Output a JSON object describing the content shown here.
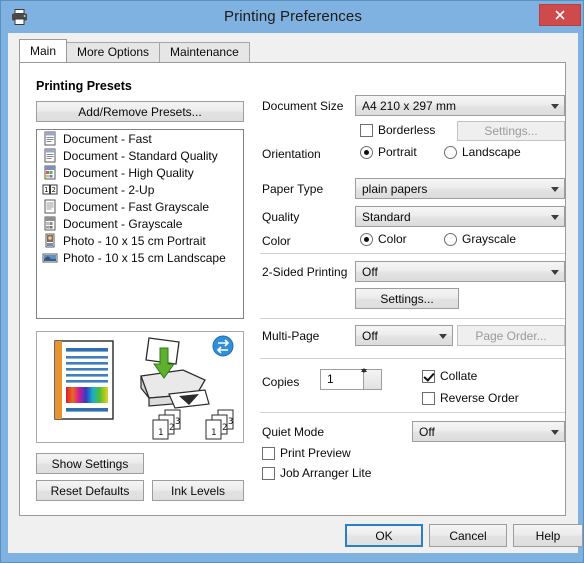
{
  "window": {
    "title": "Printing Preferences",
    "app_icon": "printer-icon",
    "close_label": "✕"
  },
  "tabs": [
    {
      "label": "Main",
      "active": true
    },
    {
      "label": "More Options",
      "active": false
    },
    {
      "label": "Maintenance",
      "active": false
    }
  ],
  "presets": {
    "section_title": "Printing Presets",
    "add_remove_label": "Add/Remove Presets...",
    "items": [
      {
        "label": "Document - Fast",
        "icon": "document-icon"
      },
      {
        "label": "Document - Standard Quality",
        "icon": "document-icon"
      },
      {
        "label": "Document - High Quality",
        "icon": "document-color-icon"
      },
      {
        "label": "Document - 2-Up",
        "icon": "two-up-icon"
      },
      {
        "label": "Document - Fast Grayscale",
        "icon": "document-gray-icon"
      },
      {
        "label": "Document - Grayscale",
        "icon": "document-gray-icon"
      },
      {
        "label": "Photo - 10 x 15 cm Portrait",
        "icon": "photo-portrait-icon"
      },
      {
        "label": "Photo - 10 x 15 cm Landscape",
        "icon": "photo-landscape-icon"
      }
    ]
  },
  "preview": {
    "page_icon": "document-preview-icon",
    "printer_icon": "printer-feed-icon",
    "swap_icon": "swap-arrows-icon",
    "stack_numbers": [
      "1",
      "2",
      "3"
    ]
  },
  "left_buttons": {
    "show_settings": "Show Settings",
    "reset_defaults": "Reset Defaults",
    "ink_levels": "Ink Levels"
  },
  "settings": {
    "document_size": {
      "label": "Document Size",
      "value": "A4 210 x 297 mm"
    },
    "borderless": {
      "label": "Borderless",
      "checked": false,
      "settings_label": "Settings...",
      "settings_enabled": false
    },
    "orientation": {
      "label": "Orientation",
      "options": [
        {
          "label": "Portrait",
          "selected": true
        },
        {
          "label": "Landscape",
          "selected": false
        }
      ]
    },
    "paper_type": {
      "label": "Paper Type",
      "value": "plain papers"
    },
    "quality": {
      "label": "Quality",
      "value": "Standard"
    },
    "color": {
      "label": "Color",
      "options": [
        {
          "label": "Color",
          "selected": true
        },
        {
          "label": "Grayscale",
          "selected": false
        }
      ]
    },
    "two_sided": {
      "label": "2-Sided Printing",
      "value": "Off",
      "settings_label": "Settings...",
      "settings_enabled": true
    },
    "multi_page": {
      "label": "Multi-Page",
      "value": "Off",
      "page_order_label": "Page Order...",
      "page_order_enabled": false
    },
    "copies": {
      "label": "Copies",
      "value": "1"
    },
    "collate": {
      "label": "Collate",
      "checked": true
    },
    "reverse_order": {
      "label": "Reverse Order",
      "checked": false
    },
    "quiet_mode": {
      "label": "Quiet Mode",
      "value": "Off"
    },
    "print_preview": {
      "label": "Print Preview",
      "checked": false
    },
    "job_arranger": {
      "label": "Job Arranger Lite",
      "checked": false
    }
  },
  "dialog_buttons": {
    "ok": "OK",
    "cancel": "Cancel",
    "help": "Help"
  },
  "colors": {
    "titlebar": "#7fb2e0",
    "close_button": "#cf4a4a",
    "accent_focus": "#2a7fc9",
    "panel": "#f0f0f0"
  }
}
